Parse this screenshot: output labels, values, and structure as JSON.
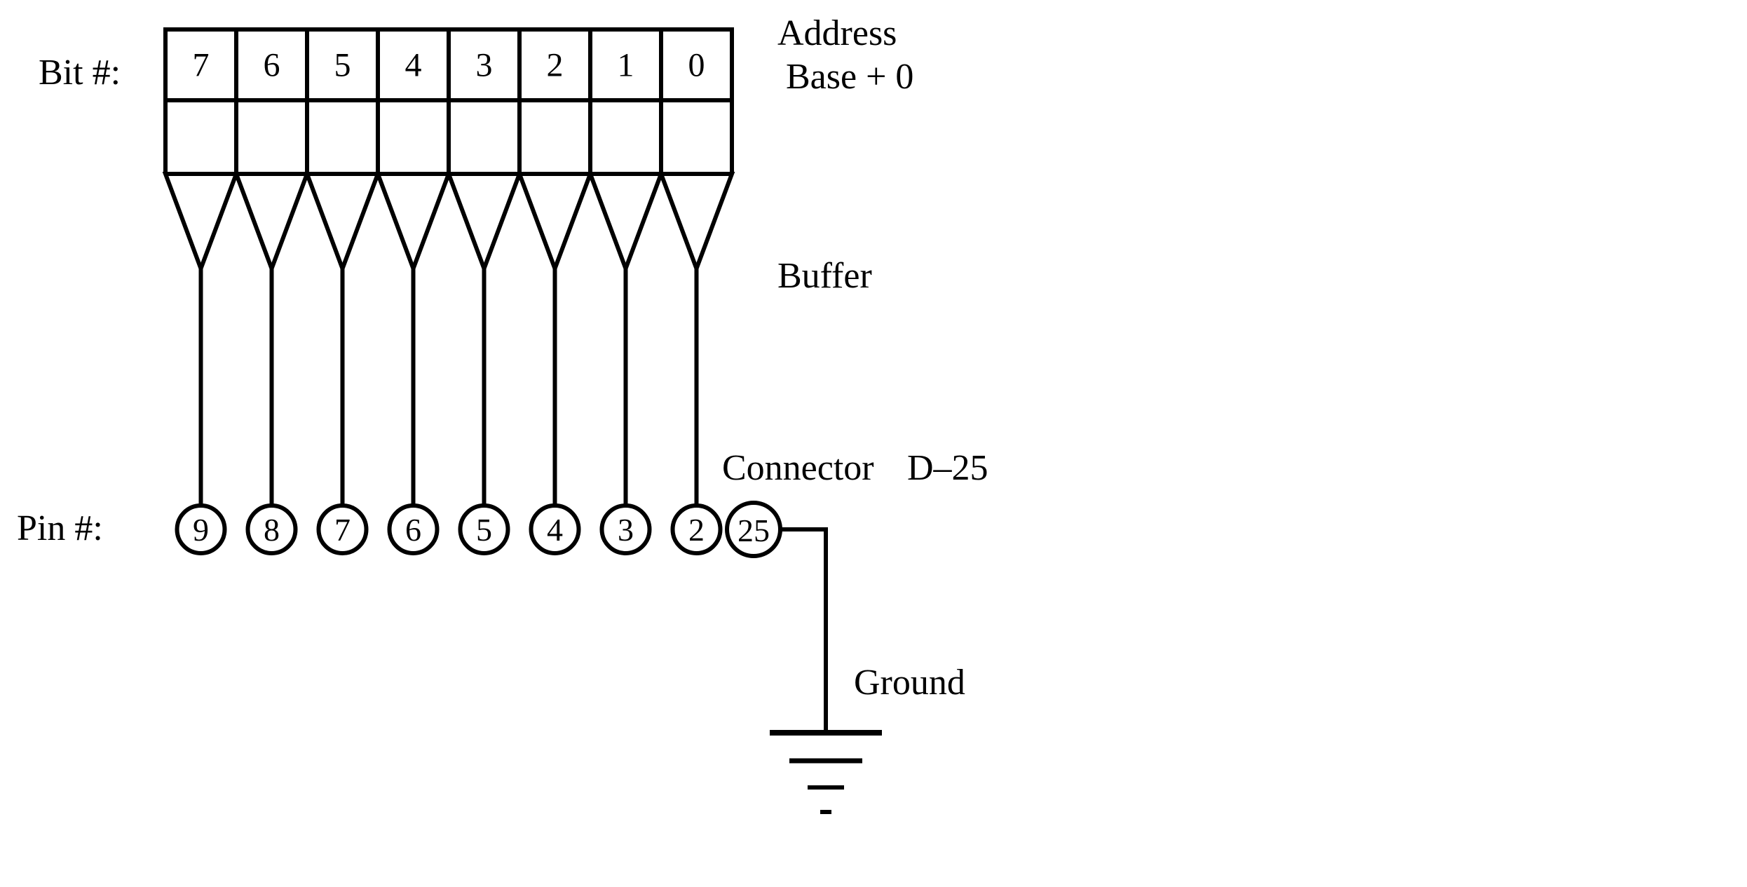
{
  "labels": {
    "bit_label": "Bit #:",
    "pin_label": "Pin #:",
    "address_line1": "Address",
    "address_line2": "Base + 0",
    "buffer": "Buffer",
    "connector": "Connector",
    "connector_type": "D–25",
    "ground": "Ground"
  },
  "bits": [
    "7",
    "6",
    "5",
    "4",
    "3",
    "2",
    "1",
    "0"
  ],
  "pins": [
    "9",
    "8",
    "7",
    "6",
    "5",
    "4",
    "3",
    "2"
  ],
  "ground_pin": "25"
}
